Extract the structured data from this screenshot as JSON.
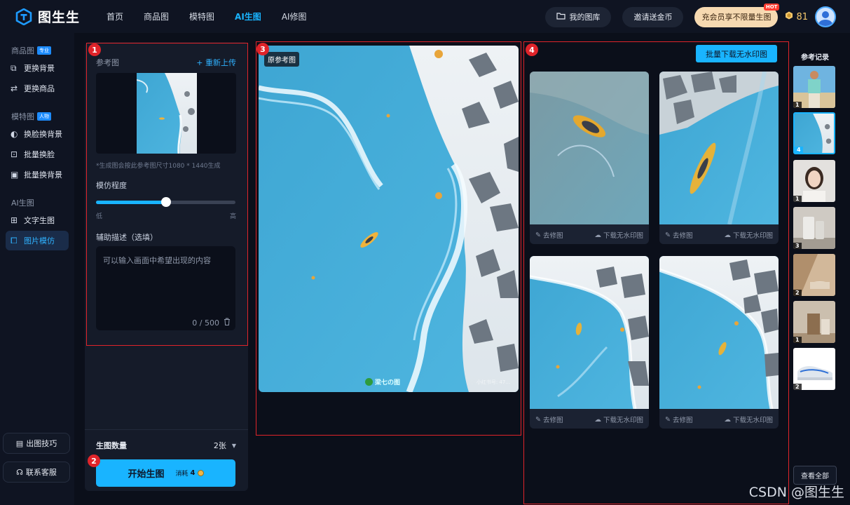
{
  "app": {
    "name": "图生生"
  },
  "nav": {
    "items": [
      {
        "label": "首页",
        "active": false
      },
      {
        "label": "商品图",
        "active": false
      },
      {
        "label": "模特图",
        "active": false
      },
      {
        "label": "AI生图",
        "active": true
      },
      {
        "label": "AI修图",
        "active": false
      }
    ]
  },
  "topbar": {
    "gallery": "我的图库",
    "invite": "邀请送金币",
    "vip": "充会员享不限量生图",
    "hot": "HOT",
    "coins": "81"
  },
  "sidebar": {
    "sections": [
      {
        "title": "商品图",
        "tag": "专业",
        "items": [
          {
            "label": "更换背景",
            "icon": "image-swap-icon"
          },
          {
            "label": "更换商品",
            "icon": "product-swap-icon"
          }
        ]
      },
      {
        "title": "模特图",
        "tag": "人物",
        "items": [
          {
            "label": "换脸换背景",
            "icon": "face-swap-icon"
          },
          {
            "label": "批量换脸",
            "icon": "batch-face-icon"
          },
          {
            "label": "批量换背景",
            "icon": "batch-bg-icon"
          }
        ]
      },
      {
        "title": "AI生图",
        "tag": "",
        "items": [
          {
            "label": "文字生图",
            "icon": "text-image-icon"
          },
          {
            "label": "图片模仿",
            "icon": "image-imitate-icon",
            "active": true
          }
        ]
      }
    ],
    "tips": "出图技巧",
    "support": "联系客服"
  },
  "settings": {
    "ref_label": "参考图",
    "reupload": "+ 重新上传",
    "note": "*生成图会按此参考图尺寸1080 * 1440生成",
    "imitation_label": "模仿程度",
    "imitation_level": 0.5,
    "low": "低",
    "high": "高",
    "desc_label": "辅助描述（选填）",
    "desc_placeholder": "可以输入画面中希望出现的内容",
    "desc_counter": "0 / 500",
    "count_label": "生图数量",
    "count_value": "2张",
    "generate": "开始生图",
    "cost_label": "消耗",
    "cost_value": "4"
  },
  "reference": {
    "label": "原参考图",
    "wm_author": "梁七の图",
    "wm_note": "小红书号: 47..."
  },
  "results": {
    "batch_download": "批量下载无水印图",
    "cards": [
      {
        "edit": "去修图",
        "download": "下载无水印图"
      },
      {
        "edit": "去修图",
        "download": "下载无水印图"
      },
      {
        "edit": "去修图",
        "download": "下载无水印图"
      },
      {
        "edit": "去修图",
        "download": "下载无水印图"
      }
    ]
  },
  "history": {
    "title": "参考记录",
    "items": [
      {
        "count": "1"
      },
      {
        "count": "4"
      },
      {
        "count": "1"
      },
      {
        "count": "3"
      },
      {
        "count": "2"
      },
      {
        "count": "1"
      },
      {
        "count": "2"
      }
    ],
    "view_all": "查看全部"
  },
  "annotations": [
    "1",
    "2",
    "3",
    "4"
  ],
  "watermark": "CSDN @图生生"
}
